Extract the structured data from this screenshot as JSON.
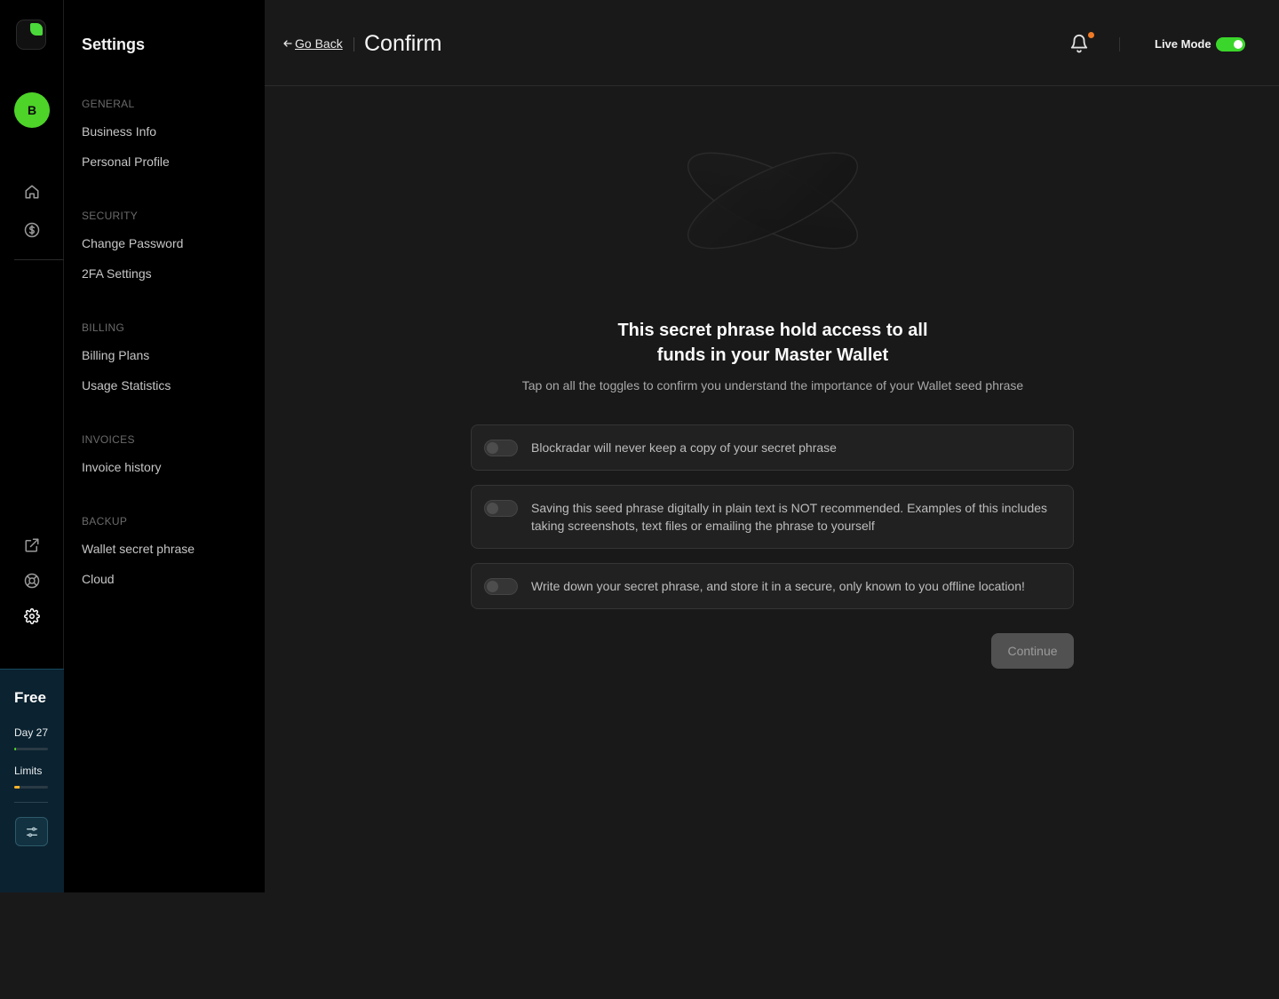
{
  "rail": {
    "avatar_initial": "B",
    "plan": {
      "name": "Free",
      "day_label": "Day 27",
      "day_progress": 0.05,
      "limits_label": "Limits",
      "limits_progress": 0.15,
      "day_bar_color": "#4ed329",
      "limits_bar_color": "#f5b52a"
    }
  },
  "settings": {
    "title": "Settings",
    "sections": [
      {
        "label": "GENERAL",
        "items": [
          "Business Info",
          "Personal Profile"
        ]
      },
      {
        "label": "SECURITY",
        "items": [
          "Change Password",
          "2FA Settings"
        ]
      },
      {
        "label": "BILLING",
        "items": [
          "Billing Plans",
          "Usage Statistics"
        ]
      },
      {
        "label": "INVOICES",
        "items": [
          "Invoice history"
        ]
      },
      {
        "label": "BACKUP",
        "items": [
          "Wallet secret phrase",
          "Cloud"
        ]
      }
    ]
  },
  "header": {
    "back_label": "Go Back",
    "title": "Confirm",
    "live_mode_label": "Live Mode",
    "live_mode_on": true
  },
  "content": {
    "headline_line1": "This secret phrase hold access to all",
    "headline_line2": "funds in your Master Wallet",
    "subline": "Tap on all the toggles to confirm you understand the importance of your Wallet seed phrase",
    "checks": [
      "Blockradar will never keep a copy of your secret phrase",
      "Saving this seed phrase digitally in plain text is NOT recommended. Examples of this includes taking screenshots, text files or emailing the phrase to yourself",
      "Write down your secret phrase, and store it in a secure, only known to you offline location!"
    ],
    "continue_label": "Continue"
  },
  "colors": {
    "accent_green": "#4ed329",
    "notification_dot": "#f07a25",
    "plan_panel_bg": "#0b2230"
  }
}
